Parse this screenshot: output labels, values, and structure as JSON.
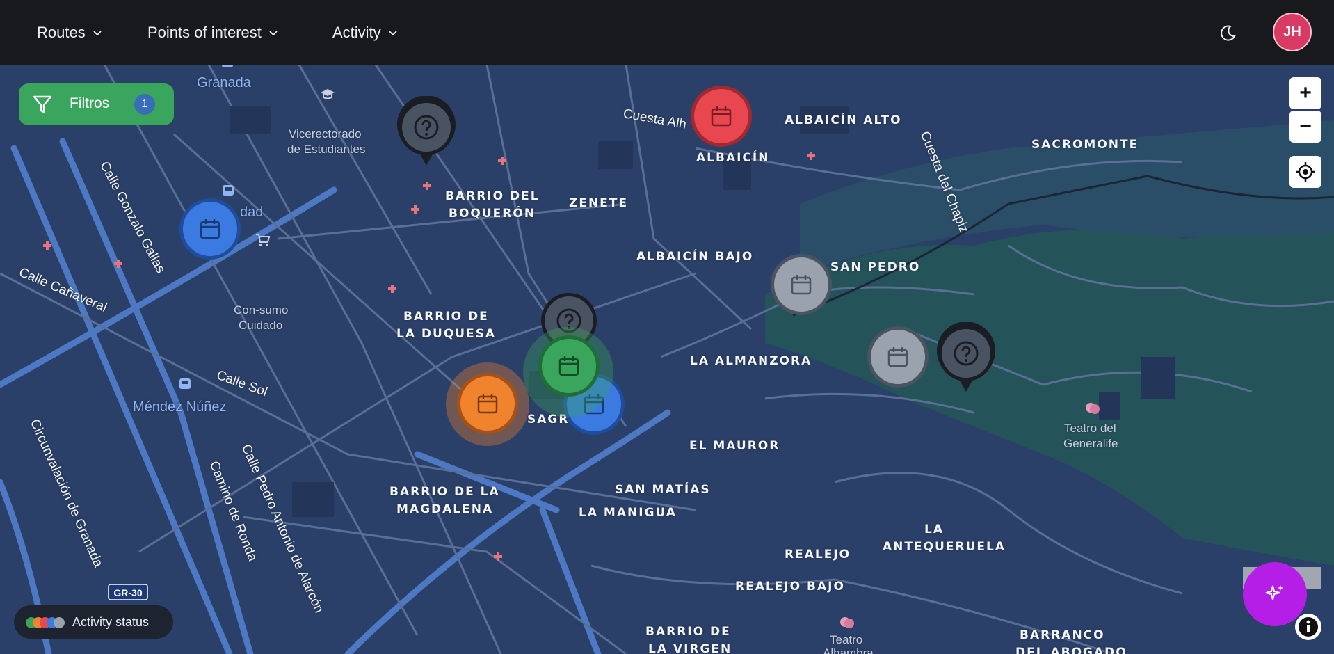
{
  "nav": {
    "items": [
      {
        "label": "Routes"
      },
      {
        "label": "Points of interest"
      },
      {
        "label": "Activity"
      }
    ],
    "theme_icon": "moon-icon",
    "avatar_initials": "JH"
  },
  "filters": {
    "label": "Filtros",
    "count": "1",
    "icon": "filter-icon"
  },
  "controls": {
    "zoom_in": "+",
    "zoom_out": "−",
    "locate_icon": "crosshair-icon"
  },
  "status": {
    "label": "Activity status",
    "colors": [
      "#3aa55c",
      "#f0832e",
      "#e8474f",
      "#3b7ae0",
      "#9aa3ad"
    ]
  },
  "fab_icon": "sparkles-icon",
  "info_icon": "info-icon",
  "map": {
    "districts": [
      "BARRIO DEL",
      "BOQUERÓN",
      "ZENETE",
      "ALBAICÍN",
      "ALBAICÍN ALTO",
      "SACROMONTE",
      "ALBAICÍN BAJO",
      "SAN PEDRO",
      "BARRIO DE",
      "LA DUQUESA",
      "LA ALMANZORA",
      "EL MAUROR",
      "SAN MATÍAS",
      "LA MANIGUA",
      "BARRIO DE LA",
      "MAGDALENA",
      "LA",
      "ANTEQUERUELA",
      "REALEJO",
      "REALEJO BAJO",
      "BARRIO DE",
      "LA VIRGEN",
      "BARRANCO",
      "DEL ABOGADO",
      "SAGR"
    ],
    "streets": [
      "Cuesta Alh",
      "Cuesta del Chapiz",
      "Calle Gonzalo Gallas",
      "Calle Cañaveral",
      "Calle Sol",
      "Circunvalación de Granada",
      "Camino de Ronda",
      "Calle Pedro Antonio de Alarcón"
    ],
    "pois": [
      "Vicerectorado",
      "de Estudiantes",
      "Con-sumo",
      "Cuidado",
      "Teatro del",
      "Generalife",
      "Teatro",
      "Alhambra",
      "dad",
      "Méndez Núñez",
      "Granada"
    ],
    "road_badge": "GR-30",
    "markers": [
      {
        "status": "unknown",
        "color": "#4a5361",
        "icon": "question-icon"
      },
      {
        "status": "cancelled",
        "color": "#e8474f",
        "icon": "calendar-icon"
      },
      {
        "status": "scheduled",
        "color": "#3b7ae0",
        "icon": "calendar-icon"
      },
      {
        "status": "inactive",
        "color": "#9aa3ad",
        "icon": "calendar-icon"
      },
      {
        "status": "unknown",
        "color": "#4a5361",
        "icon": "question-icon"
      },
      {
        "status": "active",
        "color": "#3aa55c",
        "icon": "calendar-icon"
      },
      {
        "status": "scheduled",
        "color": "#3b7ae0",
        "icon": "calendar-icon"
      },
      {
        "status": "pending",
        "color": "#f0832e",
        "icon": "calendar-icon"
      },
      {
        "status": "inactive",
        "color": "#9aa3ad",
        "icon": "calendar-icon"
      },
      {
        "status": "unknown",
        "color": "#4a5361",
        "icon": "question-icon"
      }
    ]
  }
}
